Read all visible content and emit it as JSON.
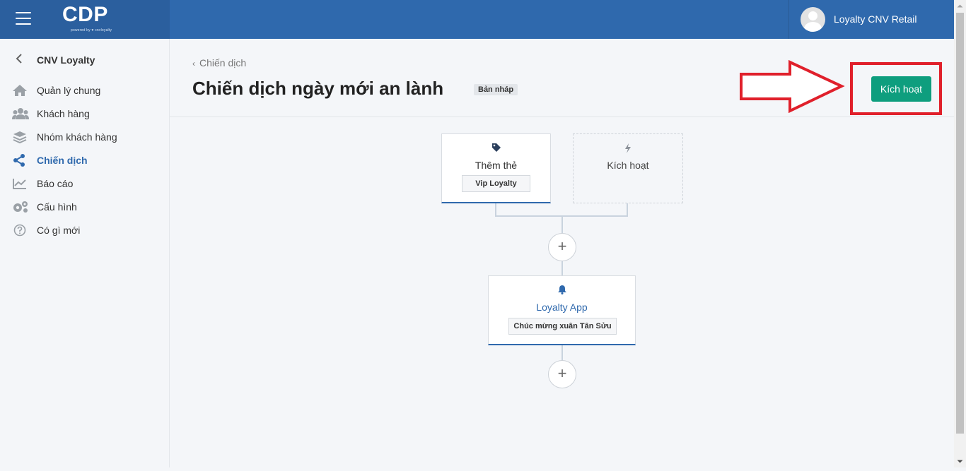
{
  "app": {
    "logo_text": "CDP",
    "logo_sub": "powered by ♥ cnvloyalty"
  },
  "user": {
    "name": "Loyalty CNV Retail"
  },
  "sidebar": {
    "back_label": "CNV Loyalty",
    "items": [
      {
        "label": "Quản lý chung",
        "icon": "home-icon"
      },
      {
        "label": "Khách hàng",
        "icon": "users-icon"
      },
      {
        "label": "Nhóm khách hàng",
        "icon": "layers-icon"
      },
      {
        "label": "Chiến dịch",
        "icon": "share-icon",
        "active": true
      },
      {
        "label": "Báo cáo",
        "icon": "chart-line-icon"
      },
      {
        "label": "Cấu hình",
        "icon": "gears-icon"
      },
      {
        "label": "Có gì mới",
        "icon": "question-circle-icon"
      }
    ]
  },
  "page": {
    "breadcrumb": "Chiến dịch",
    "title": "Chiến dịch ngày mới an lành",
    "status": "Bản nháp",
    "activate_label": "Kích hoạt"
  },
  "flow": {
    "trigger_card": {
      "title": "Thêm thẻ",
      "tag": "Vip Loyalty",
      "icon": "tag-icon"
    },
    "activation_card": {
      "title": "Kích hoạt",
      "icon": "bolt-icon"
    },
    "action_card": {
      "title": "Loyalty App",
      "tag": "Chúc mừng xuân Tân Sửu",
      "icon": "bell-icon"
    },
    "add_symbol": "+"
  },
  "colors": {
    "header": "#2f69ad",
    "accent": "#2f69ad",
    "activate_button": "#0e9e7e",
    "highlight": "#e0202b"
  }
}
